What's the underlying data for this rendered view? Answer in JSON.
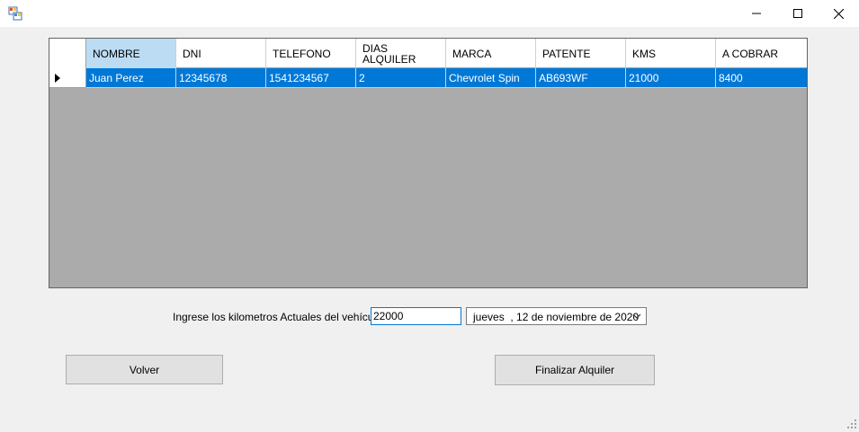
{
  "window": {
    "title": "",
    "controls": {
      "minimize": "minimize-icon",
      "maximize": "maximize-icon",
      "close": "close-icon"
    }
  },
  "grid": {
    "columns": [
      {
        "label": "NOMBRE",
        "selected": true
      },
      {
        "label": "DNI"
      },
      {
        "label": "TELEFONO"
      },
      {
        "label": "DIAS\nALQUILER"
      },
      {
        "label": "MARCA"
      },
      {
        "label": "PATENTE"
      },
      {
        "label": "KMS"
      },
      {
        "label": "A COBRAR"
      }
    ],
    "rows": [
      {
        "current": true,
        "cells": [
          "Juan Perez",
          "12345678",
          "1541234567",
          "2",
          "Chevrolet Spin",
          "AB693WF",
          "21000",
          "8400"
        ]
      }
    ]
  },
  "form": {
    "km_label": "Ingrese los kilometros Actuales del vehículo:",
    "km_value": "22000",
    "date_value": "jueves  , 12 de noviembre de 2020",
    "date_icon": "chevron-down-icon"
  },
  "buttons": {
    "volver": "Volver",
    "finalizar": "Finalizar Alquiler"
  },
  "colors": {
    "selection": "#0078d7",
    "header_selected": "#bcdcf4",
    "grid_background": "#ababab",
    "window_background": "#f0f0f0"
  }
}
